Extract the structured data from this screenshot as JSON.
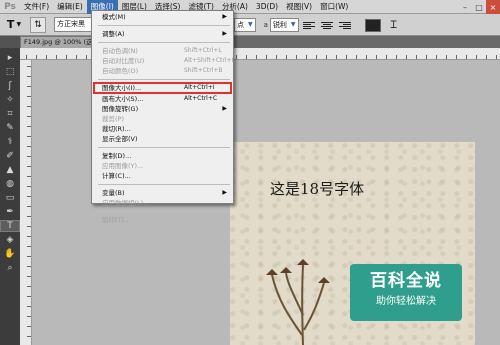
{
  "app": {
    "logo": "Ps"
  },
  "menubar": {
    "items": [
      "文件(F)",
      "编辑(E)",
      "图像(I)",
      "图层(L)",
      "选择(S)",
      "滤镜(T)",
      "分析(A)",
      "3D(D)",
      "视图(V)",
      "窗口(W)"
    ],
    "active_index": 2
  },
  "window_buttons": [
    "–",
    "□",
    "×"
  ],
  "options_bar": {
    "tool_icon": "T",
    "font_name": "方正宋黑",
    "size_suffix": "点",
    "aa_label": "a",
    "aa_value": "锐利",
    "color": "#222222"
  },
  "document": {
    "tab_title": "F149.jpg @ 100% (这"
  },
  "tools": [
    "▸",
    "⬚",
    "ʃ",
    "✧",
    "⌗",
    "✎",
    "⚕",
    "✐",
    "▲",
    "◍",
    "▭",
    "✒",
    "T",
    "◈",
    "✋",
    "⌕"
  ],
  "canvas": {
    "text": "这是18号字体"
  },
  "watermark": {
    "title": "百科全说",
    "subtitle": "助你轻松解决"
  },
  "image_menu": {
    "items": [
      {
        "label": "模式(M)",
        "shortcut": "",
        "submenu": true,
        "disabled": false
      },
      {
        "sep": true
      },
      {
        "label": "调整(A)",
        "shortcut": "",
        "submenu": true,
        "disabled": false
      },
      {
        "sep": true
      },
      {
        "label": "自动色调(N)",
        "shortcut": "Shift+Ctrl+L",
        "submenu": false,
        "disabled": true
      },
      {
        "label": "自动对比度(U)",
        "shortcut": "Alt+Shift+Ctrl+L",
        "submenu": false,
        "disabled": true
      },
      {
        "label": "自动颜色(O)",
        "shortcut": "Shift+Ctrl+B",
        "submenu": false,
        "disabled": true
      },
      {
        "sep": true
      },
      {
        "label": "图像大小(I)...",
        "shortcut": "Alt+Ctrl+I",
        "submenu": false,
        "disabled": false,
        "highlight": true
      },
      {
        "label": "画布大小(S)...",
        "shortcut": "Alt+Ctrl+C",
        "submenu": false,
        "disabled": false
      },
      {
        "label": "图像旋转(G)",
        "shortcut": "",
        "submenu": true,
        "disabled": false
      },
      {
        "label": "裁剪(P)",
        "shortcut": "",
        "submenu": false,
        "disabled": true
      },
      {
        "label": "裁切(R)...",
        "shortcut": "",
        "submenu": false,
        "disabled": false
      },
      {
        "label": "显示全部(V)",
        "shortcut": "",
        "submenu": false,
        "disabled": false
      },
      {
        "sep": true
      },
      {
        "label": "复制(D)...",
        "shortcut": "",
        "submenu": false,
        "disabled": false
      },
      {
        "label": "应用图像(Y)...",
        "shortcut": "",
        "submenu": false,
        "disabled": true
      },
      {
        "label": "计算(C)...",
        "shortcut": "",
        "submenu": false,
        "disabled": false
      },
      {
        "sep": true
      },
      {
        "label": "变量(B)",
        "shortcut": "",
        "submenu": true,
        "disabled": false
      },
      {
        "label": "应用数据组(L)...",
        "shortcut": "",
        "submenu": false,
        "disabled": true
      },
      {
        "sep": true
      },
      {
        "label": "陷印(T)...",
        "shortcut": "",
        "submenu": false,
        "disabled": true
      }
    ]
  }
}
